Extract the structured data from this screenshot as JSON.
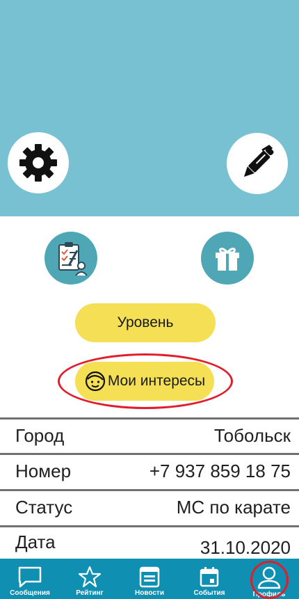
{
  "profile_actions": {
    "settings_icon": "gear-icon",
    "edit_icon": "pen-icon",
    "tasks_icon": "clipboard-icon",
    "gift_icon": "gift-icon",
    "level_label": "Уровень",
    "interests_label": "Мои интересы",
    "interests_icon": "face-icon"
  },
  "info": [
    {
      "label": "Город",
      "value": "Тобольск"
    },
    {
      "label": "Номер",
      "value": "+7 937 859 18 75"
    },
    {
      "label": "Статус",
      "value": "МС по карате"
    },
    {
      "label": "Дата",
      "value": "31.10.2020"
    }
  ],
  "nav": [
    {
      "label": "Сообщения",
      "icon": "chat-icon"
    },
    {
      "label": "Рейтинг",
      "icon": "star-icon"
    },
    {
      "label": "Новости",
      "icon": "newspaper-icon"
    },
    {
      "label": "События",
      "icon": "calendar-icon"
    },
    {
      "label": "Профиль",
      "icon": "user-icon",
      "active": true
    }
  ],
  "colors": {
    "header": "#78c1d2",
    "button_yellow": "#f4df55",
    "icon_teal": "#4fa7b6",
    "nav_bar": "#0f8fb2",
    "highlight_red": "#e01d2a"
  }
}
